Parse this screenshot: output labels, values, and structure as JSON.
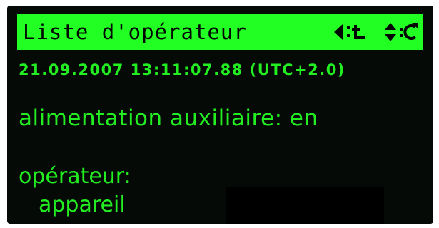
{
  "title_bar": {
    "title": "Liste d'opérateur",
    "icons": [
      "back-icon",
      "enter-icon",
      "up-down-icon",
      "refresh-icon"
    ]
  },
  "status": {
    "timestamp": "21.09.2007 13:11:07.88 (UTC+2.0)"
  },
  "content": {
    "aux_power_line": "alimentation auxiliaire: en",
    "operator_label": "opérateur:",
    "operator_value": "appareil"
  },
  "colors": {
    "lcd_green": "#22ff22",
    "lcd_text_green": "#22ee22",
    "lcd_background": "#060a06"
  }
}
